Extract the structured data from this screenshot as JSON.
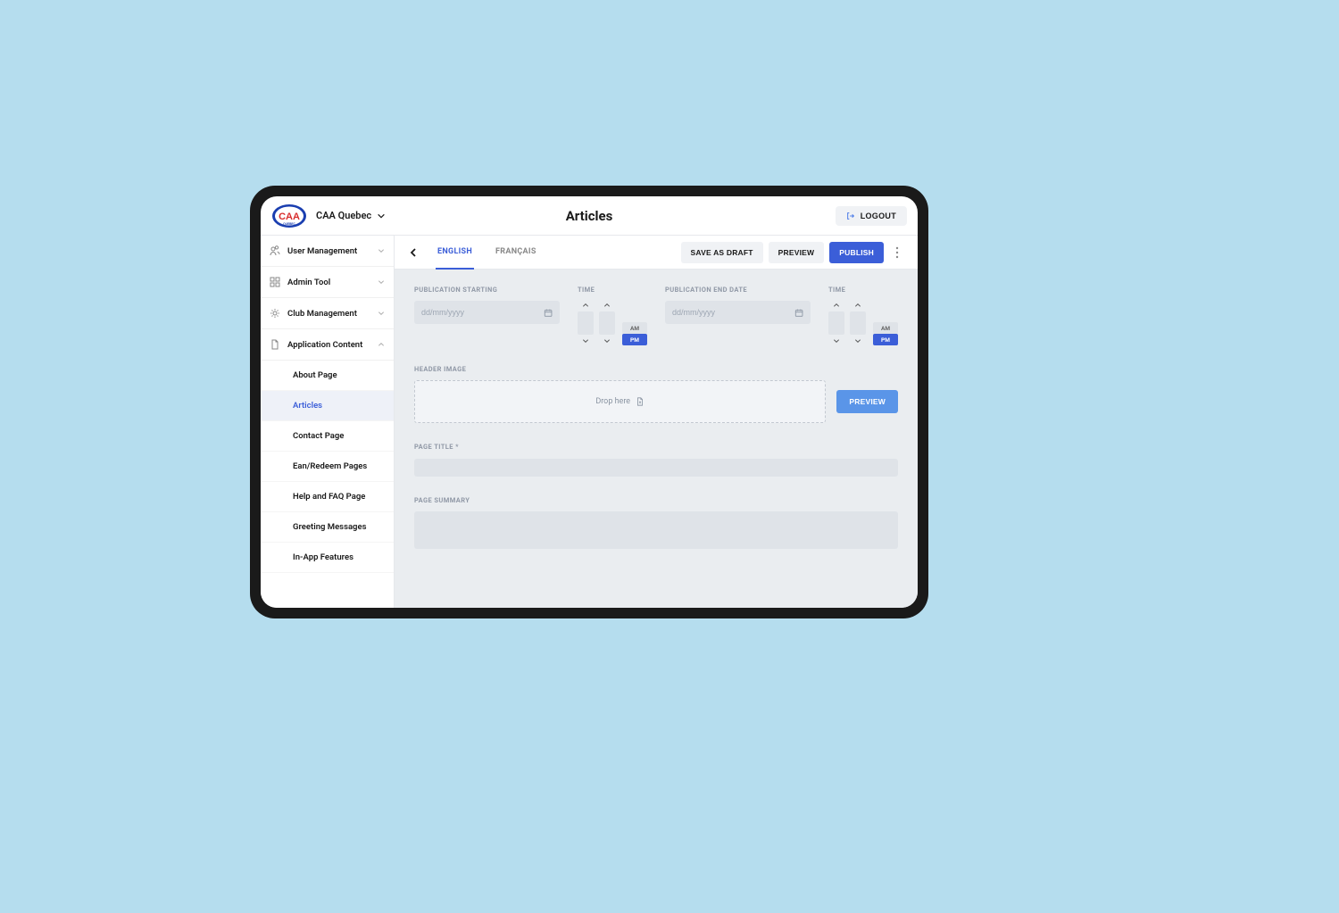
{
  "header": {
    "club_name": "CAA Quebec",
    "page_title": "Articles",
    "logout_label": "LOGOUT"
  },
  "sidebar": {
    "items": [
      {
        "label": "User Management",
        "icon": "users-icon",
        "expanded": false
      },
      {
        "label": "Admin Tool",
        "icon": "grid-icon",
        "expanded": false
      },
      {
        "label": "Club Management",
        "icon": "gear-icon",
        "expanded": false
      },
      {
        "label": "Application Content",
        "icon": "document-icon",
        "expanded": true,
        "children": [
          {
            "label": "About Page",
            "active": false
          },
          {
            "label": "Articles",
            "active": true
          },
          {
            "label": "Contact Page",
            "active": false
          },
          {
            "label": "Ean/Redeem Pages",
            "active": false
          },
          {
            "label": "Help and FAQ Page",
            "active": false
          },
          {
            "label": "Greeting Messages",
            "active": false
          },
          {
            "label": "In-App Features",
            "active": false
          }
        ]
      }
    ]
  },
  "toolbar": {
    "tabs": [
      {
        "label": "ENGLISH",
        "active": true
      },
      {
        "label": "FRANÇAIS",
        "active": false
      }
    ],
    "save_draft_label": "SAVE AS DRAFT",
    "preview_label": "PREVIEW",
    "publish_label": "PUBLISH"
  },
  "form": {
    "pub_start_label": "PUBLICATION STARTING",
    "pub_end_label": "PUBLICATION END DATE",
    "time_label": "TIME",
    "date_placeholder": "dd/mm/yyyy",
    "am_label": "AM",
    "pm_label": "PM",
    "header_image_label": "HEADER IMAGE",
    "drop_here_label": "Drop here",
    "image_preview_label": "PREVIEW",
    "page_title_label": "PAGE TITLE *",
    "page_summary_label": "PAGE SUMMARY"
  }
}
